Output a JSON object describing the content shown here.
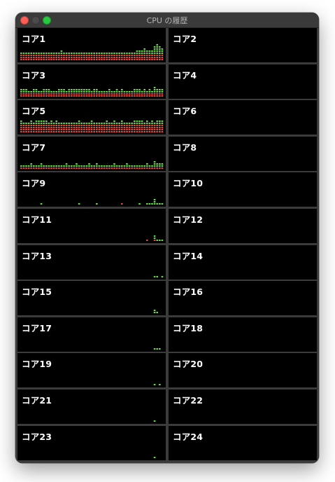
{
  "window": {
    "title": "CPU の履歴",
    "traffic_lights": {
      "close": "#ff5f57",
      "minimize": "#4a4a4a",
      "zoom": "#28c840"
    }
  },
  "colors": {
    "background": "#000000",
    "divider": "#3b3b3b",
    "user_load": "#5fdc3c",
    "system_load": "#e8443a",
    "label": "#ffffff"
  },
  "cores": [
    {
      "label": "コア1",
      "green": [
        1,
        1,
        1,
        1,
        1,
        1,
        1,
        1,
        1,
        1,
        1,
        1,
        1,
        1,
        1,
        1,
        2,
        1,
        1,
        1,
        1,
        1,
        1,
        1,
        1,
        1,
        1,
        1,
        1,
        1,
        1,
        1,
        1,
        1,
        1,
        1,
        1,
        1,
        1,
        1,
        1,
        1,
        1,
        1,
        1,
        1,
        2,
        2,
        2,
        3,
        2,
        2,
        2,
        4,
        5,
        4,
        3
      ],
      "red": [
        3,
        3,
        3,
        3,
        3,
        3,
        3,
        3,
        3,
        3,
        3,
        3,
        3,
        3,
        3,
        3,
        3,
        3,
        3,
        3,
        3,
        3,
        3,
        3,
        3,
        3,
        3,
        3,
        3,
        3,
        3,
        3,
        3,
        3,
        3,
        3,
        3,
        3,
        3,
        3,
        3,
        3,
        3,
        3,
        3,
        3,
        3,
        3,
        3,
        3,
        3,
        3,
        3,
        3,
        3,
        3,
        3
      ]
    },
    {
      "label": "コア2",
      "green": [],
      "red": []
    },
    {
      "label": "コア3",
      "green": [
        2,
        2,
        2,
        1,
        1,
        2,
        2,
        1,
        1,
        2,
        2,
        2,
        1,
        1,
        1,
        2,
        2,
        2,
        1,
        2,
        2,
        2,
        2,
        2,
        2,
        2,
        2,
        2,
        1,
        2,
        2,
        1,
        1,
        1,
        1,
        2,
        1,
        1,
        2,
        1,
        2,
        1,
        1,
        1,
        1,
        2,
        2,
        2,
        1,
        2,
        1,
        2,
        1,
        3,
        2,
        2,
        2
      ],
      "red": [
        2,
        2,
        2,
        2,
        2,
        2,
        2,
        2,
        2,
        2,
        2,
        2,
        2,
        2,
        2,
        2,
        2,
        2,
        2,
        2,
        2,
        2,
        2,
        2,
        2,
        2,
        2,
        2,
        2,
        2,
        2,
        2,
        2,
        2,
        2,
        2,
        2,
        2,
        2,
        2,
        2,
        2,
        2,
        2,
        2,
        2,
        2,
        2,
        2,
        2,
        2,
        2,
        2,
        2,
        2,
        2,
        2
      ]
    },
    {
      "label": "コア4",
      "green": [],
      "red": []
    },
    {
      "label": "コア5",
      "green": [
        2,
        1,
        1,
        1,
        2,
        1,
        2,
        2,
        2,
        2,
        2,
        1,
        2,
        1,
        2,
        1,
        1,
        1,
        1,
        1,
        1,
        1,
        1,
        2,
        1,
        1,
        1,
        1,
        2,
        1,
        1,
        1,
        1,
        1,
        2,
        1,
        1,
        2,
        1,
        1,
        2,
        1,
        1,
        1,
        1,
        2,
        2,
        2,
        2,
        1,
        2,
        1,
        2,
        1,
        2,
        2,
        2
      ],
      "red": [
        4,
        4,
        4,
        4,
        4,
        4,
        4,
        4,
        4,
        4,
        4,
        4,
        4,
        4,
        4,
        4,
        4,
        4,
        4,
        4,
        4,
        4,
        4,
        4,
        4,
        4,
        4,
        4,
        4,
        4,
        4,
        4,
        4,
        4,
        4,
        4,
        4,
        4,
        4,
        4,
        4,
        4,
        4,
        4,
        4,
        4,
        4,
        4,
        4,
        4,
        4,
        4,
        4,
        4,
        4,
        4,
        4
      ]
    },
    {
      "label": "コア6",
      "green": [],
      "red": []
    },
    {
      "label": "コア7",
      "green": [
        1,
        1,
        1,
        1,
        2,
        1,
        1,
        1,
        2,
        1,
        1,
        1,
        1,
        1,
        1,
        1,
        1,
        1,
        2,
        1,
        1,
        1,
        2,
        1,
        1,
        1,
        1,
        2,
        1,
        1,
        2,
        1,
        1,
        1,
        1,
        1,
        1,
        2,
        1,
        1,
        1,
        1,
        2,
        1,
        1,
        1,
        1,
        1,
        1,
        1,
        2,
        1,
        1,
        3,
        2,
        2,
        2
      ],
      "red": [
        1,
        1,
        1,
        1,
        1,
        1,
        1,
        1,
        1,
        1,
        1,
        1,
        1,
        1,
        1,
        1,
        1,
        1,
        1,
        1,
        1,
        1,
        1,
        1,
        1,
        1,
        1,
        1,
        1,
        1,
        1,
        1,
        1,
        1,
        1,
        1,
        1,
        1,
        1,
        1,
        1,
        1,
        1,
        1,
        1,
        1,
        1,
        1,
        1,
        1,
        1,
        1,
        1,
        1,
        1,
        1,
        1
      ]
    },
    {
      "label": "コア8",
      "green": [],
      "red": []
    },
    {
      "label": "コア9",
      "green": [
        0,
        0,
        0,
        0,
        0,
        0,
        0,
        0,
        1,
        0,
        0,
        0,
        0,
        0,
        0,
        0,
        0,
        0,
        0,
        0,
        0,
        0,
        0,
        1,
        0,
        0,
        0,
        0,
        0,
        0,
        1,
        0,
        0,
        0,
        0,
        0,
        0,
        0,
        0,
        0,
        0,
        0,
        0,
        0,
        0,
        0,
        0,
        1,
        0,
        0,
        1,
        1,
        1,
        3,
        1,
        1,
        1
      ],
      "red": [
        0,
        0,
        0,
        0,
        0,
        0,
        0,
        0,
        0,
        0,
        0,
        0,
        0,
        0,
        0,
        0,
        0,
        0,
        0,
        0,
        0,
        0,
        0,
        0,
        0,
        0,
        0,
        0,
        0,
        0,
        0,
        0,
        0,
        0,
        0,
        0,
        0,
        0,
        0,
        0,
        1,
        0,
        0,
        0,
        0,
        0,
        0,
        0,
        0,
        0,
        0,
        0,
        0,
        0,
        0,
        0,
        0
      ]
    },
    {
      "label": "コア10",
      "green": [],
      "red": []
    },
    {
      "label": "コア11",
      "green": [
        0,
        0,
        0,
        0,
        0,
        0,
        0,
        0,
        0,
        0,
        0,
        0,
        0,
        0,
        0,
        0,
        0,
        0,
        0,
        0,
        0,
        0,
        0,
        0,
        0,
        0,
        0,
        0,
        0,
        0,
        0,
        0,
        0,
        0,
        0,
        0,
        0,
        0,
        0,
        0,
        0,
        0,
        0,
        0,
        0,
        0,
        0,
        0,
        0,
        0,
        0,
        0,
        0,
        2,
        1,
        1,
        1
      ],
      "red": [
        0,
        0,
        0,
        0,
        0,
        0,
        0,
        0,
        0,
        0,
        0,
        0,
        0,
        0,
        0,
        0,
        0,
        0,
        0,
        0,
        0,
        0,
        0,
        0,
        0,
        0,
        0,
        0,
        0,
        0,
        0,
        0,
        0,
        0,
        0,
        0,
        0,
        0,
        0,
        0,
        0,
        0,
        0,
        0,
        0,
        0,
        0,
        0,
        0,
        0,
        1,
        0,
        0,
        1,
        0,
        0,
        0
      ]
    },
    {
      "label": "コア12",
      "green": [],
      "red": []
    },
    {
      "label": "コア13",
      "green": [
        0,
        0,
        0,
        0,
        0,
        0,
        0,
        0,
        0,
        0,
        0,
        0,
        0,
        0,
        0,
        0,
        0,
        0,
        0,
        0,
        0,
        0,
        0,
        0,
        0,
        0,
        0,
        0,
        0,
        0,
        0,
        0,
        0,
        0,
        0,
        0,
        0,
        0,
        0,
        0,
        0,
        0,
        0,
        0,
        0,
        0,
        0,
        0,
        0,
        0,
        0,
        0,
        0,
        1,
        1,
        0,
        1
      ],
      "red": []
    },
    {
      "label": "コア14",
      "green": [],
      "red": []
    },
    {
      "label": "コア15",
      "green": [
        0,
        0,
        0,
        0,
        0,
        0,
        0,
        0,
        0,
        0,
        0,
        0,
        0,
        0,
        0,
        0,
        0,
        0,
        0,
        0,
        0,
        0,
        0,
        0,
        0,
        0,
        0,
        0,
        0,
        0,
        0,
        0,
        0,
        0,
        0,
        0,
        0,
        0,
        0,
        0,
        0,
        0,
        0,
        0,
        0,
        0,
        0,
        0,
        0,
        0,
        0,
        0,
        0,
        2,
        1,
        0,
        0
      ],
      "red": []
    },
    {
      "label": "コア16",
      "green": [],
      "red": []
    },
    {
      "label": "コア17",
      "green": [
        0,
        0,
        0,
        0,
        0,
        0,
        0,
        0,
        0,
        0,
        0,
        0,
        0,
        0,
        0,
        0,
        0,
        0,
        0,
        0,
        0,
        0,
        0,
        0,
        0,
        0,
        0,
        0,
        0,
        0,
        0,
        0,
        0,
        0,
        0,
        0,
        0,
        0,
        0,
        0,
        0,
        0,
        0,
        0,
        0,
        0,
        0,
        0,
        0,
        0,
        0,
        0,
        0,
        1,
        1,
        1,
        0
      ],
      "red": []
    },
    {
      "label": "コア18",
      "green": [],
      "red": []
    },
    {
      "label": "コア19",
      "green": [
        0,
        0,
        0,
        0,
        0,
        0,
        0,
        0,
        0,
        0,
        0,
        0,
        0,
        0,
        0,
        0,
        0,
        0,
        0,
        0,
        0,
        0,
        0,
        0,
        0,
        0,
        0,
        0,
        0,
        0,
        0,
        0,
        0,
        0,
        0,
        0,
        0,
        0,
        0,
        0,
        0,
        0,
        0,
        0,
        0,
        0,
        0,
        0,
        0,
        0,
        0,
        0,
        0,
        1,
        0,
        1,
        0
      ],
      "red": []
    },
    {
      "label": "コア20",
      "green": [],
      "red": []
    },
    {
      "label": "コア21",
      "green": [
        0,
        0,
        0,
        0,
        0,
        0,
        0,
        0,
        0,
        0,
        0,
        0,
        0,
        0,
        0,
        0,
        0,
        0,
        0,
        0,
        0,
        0,
        0,
        0,
        0,
        0,
        0,
        0,
        0,
        0,
        0,
        0,
        0,
        0,
        0,
        0,
        0,
        0,
        0,
        0,
        0,
        0,
        0,
        0,
        0,
        0,
        0,
        0,
        0,
        0,
        0,
        0,
        0,
        1,
        0,
        0,
        0
      ],
      "red": []
    },
    {
      "label": "コア22",
      "green": [],
      "red": []
    },
    {
      "label": "コア23",
      "green": [
        0,
        0,
        0,
        0,
        0,
        0,
        0,
        0,
        0,
        0,
        0,
        0,
        0,
        0,
        0,
        0,
        0,
        0,
        0,
        0,
        0,
        0,
        0,
        0,
        0,
        0,
        0,
        0,
        0,
        0,
        0,
        0,
        0,
        0,
        0,
        0,
        0,
        0,
        0,
        0,
        0,
        0,
        0,
        0,
        0,
        0,
        0,
        0,
        0,
        0,
        0,
        0,
        0,
        1,
        0,
        0,
        0
      ],
      "red": []
    },
    {
      "label": "コア24",
      "green": [],
      "red": []
    }
  ]
}
